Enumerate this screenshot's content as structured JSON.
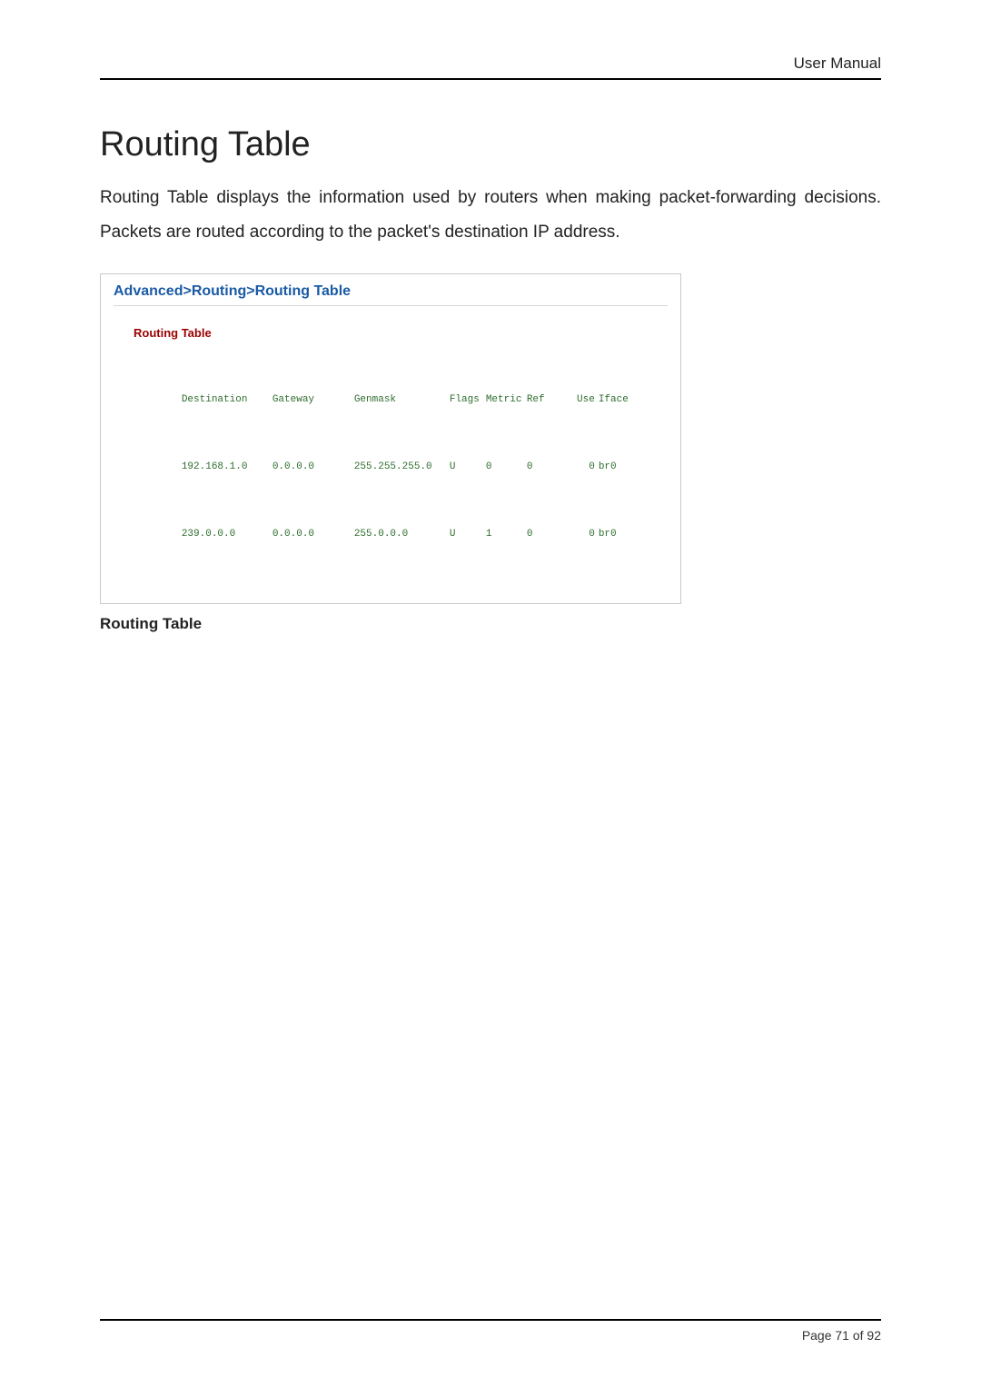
{
  "header": {
    "label": "User Manual"
  },
  "title": "Routing Table",
  "description": "Routing Table displays the information used by routers when making packet-forwarding decisions. Packets are routed according to the packet's destination IP address.",
  "panel": {
    "breadcrumb": "Advanced>Routing>Routing Table",
    "subtitle": "Routing Table",
    "columns": {
      "destination": "Destination",
      "gateway": "Gateway",
      "genmask": "Genmask",
      "flags": "Flags",
      "metric": "Metric",
      "ref": "Ref",
      "use": "Use",
      "iface": "Iface"
    },
    "rows": [
      {
        "destination": "192.168.1.0",
        "gateway": "0.0.0.0",
        "genmask": "255.255.255.0",
        "flags": "U",
        "metric": "0",
        "ref": "0",
        "use": "0",
        "iface": "br0"
      },
      {
        "destination": "239.0.0.0",
        "gateway": "0.0.0.0",
        "genmask": "255.0.0.0",
        "flags": "U",
        "metric": "1",
        "ref": "0",
        "use": "0",
        "iface": "br0"
      }
    ]
  },
  "caption": "Routing Table",
  "footer": {
    "page_label": "Page 71 of 92"
  }
}
